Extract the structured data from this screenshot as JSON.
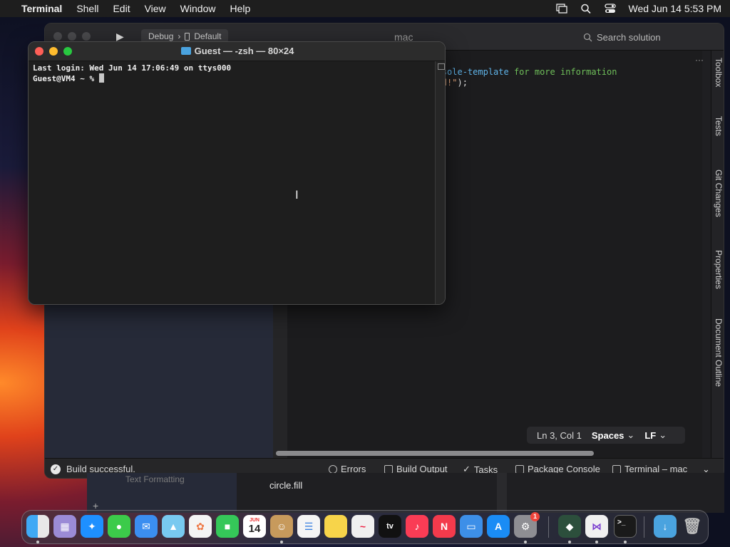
{
  "menubar": {
    "app": "Terminal",
    "items": [
      "Shell",
      "Edit",
      "View",
      "Window",
      "Help"
    ],
    "datetime": "Wed Jun 14  5:53 PM"
  },
  "ide": {
    "scheme": "Debug",
    "scheme_sep": "›",
    "device": "Default",
    "title": "mac",
    "search_placeholder": "Search solution",
    "code_line1_a": "/new-console-template",
    "code_line1_b": " for more information",
    "code_line2_a": "lo, World!\"",
    "code_line2_b": ");",
    "sidebar_tabs": [
      "Toolbox",
      "Tests",
      "Git Changes",
      "Properties",
      "Document Outline"
    ],
    "status": {
      "position": "Ln 3, Col 1",
      "indent": "Spaces",
      "eol": "LF"
    },
    "build_status": "Build successful.",
    "bottom_tabs": [
      "Errors",
      "Build Output",
      "Tasks",
      "Package Console",
      "Terminal – mac"
    ],
    "behind_text1": "Text Formatting",
    "behind_text2": "circle.fill"
  },
  "terminal": {
    "title": "Guest — -zsh — 80×24",
    "line1": "Last login: Wed Jun 14 17:06:49 on ttys000",
    "prompt": "Guest@VM4 ~ % "
  },
  "dock": {
    "calendar_month": "JUN",
    "calendar_day": "14",
    "tv_label": "tv",
    "settings_badge": "1",
    "terminal_glyph": ">_"
  },
  "colors": {
    "menubar_bg": "#1e1e1e",
    "terminal_bg": "#1e1e1e",
    "accent_blue": "#4aa3df"
  }
}
